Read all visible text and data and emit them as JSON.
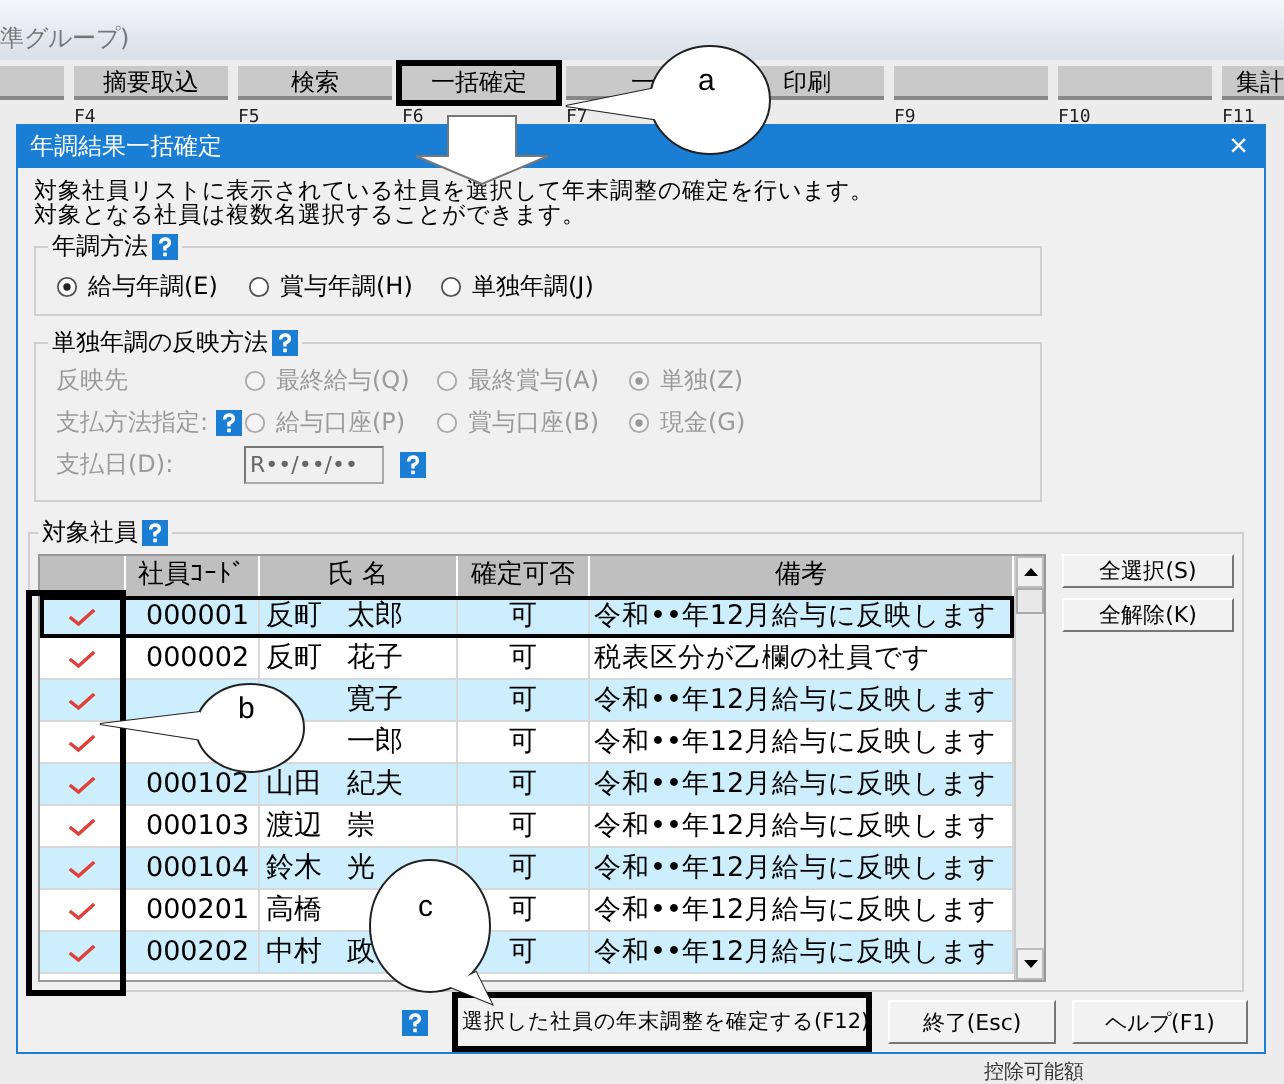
{
  "app": {
    "title": "準グループ)",
    "toolbar": [
      {
        "highlighted": false
      },
      {
        "label": "摘要取込",
        "fkey": "F4",
        "highlighted": false
      },
      {
        "label": "検索",
        "fkey": "F5",
        "highlighted": false
      },
      {
        "label": "一括確定",
        "fkey": "F6",
        "highlighted": true
      },
      {
        "label": "一",
        "fkey": "F7",
        "highlighted": false
      },
      {
        "label": "印刷",
        "highlighted": false
      },
      {
        "fkey": "F9",
        "highlighted": false
      },
      {
        "fkey": "F10",
        "highlighted": false
      },
      {
        "label": "集計",
        "fkey": "F11",
        "highlighted": false
      }
    ],
    "footer_text": "控除可能額"
  },
  "dialog": {
    "title": "年調結果一括確定",
    "close": "×",
    "intro": [
      "対象社員リストに表示されている社員を選択して年末調整の確定を行います。",
      "対象となる社員は複数名選択することができます。"
    ],
    "method": {
      "title": "年調方法",
      "help": true,
      "options": [
        {
          "label": "給与年調(E)",
          "selected": true
        },
        {
          "label": "賞与年調(H)",
          "selected": false
        },
        {
          "label": "単独年調(J)",
          "selected": false
        }
      ]
    },
    "reflect": {
      "title": "単独年調の反映方法",
      "help": true,
      "disabled": true,
      "rows": [
        {
          "kind": "radios",
          "label": "反映先",
          "help": false,
          "options": [
            {
              "label": "最終給与(Q)",
              "selected": false
            },
            {
              "label": "最終賞与(A)",
              "selected": false
            },
            {
              "label": "単独(Z)",
              "selected": true
            }
          ]
        },
        {
          "kind": "radios",
          "label": "支払方法指定:",
          "help": true,
          "options": [
            {
              "label": "給与口座(P)",
              "selected": false
            },
            {
              "label": "賞与口座(B)",
              "selected": false
            },
            {
              "label": "現金(G)",
              "selected": true
            }
          ]
        },
        {
          "kind": "date",
          "label": "支払日(D):",
          "value": "R••/••/••",
          "help": true
        }
      ]
    },
    "employees": {
      "title": "対象社員",
      "help": true,
      "check_column_highlighted": true,
      "columns": [
        "社員ｺｰﾄﾞ",
        "氏 名",
        "確定可否",
        "備考"
      ],
      "rows": [
        {
          "checked": true,
          "focused": true,
          "code": "000001",
          "family": "反町",
          "given": "太郎",
          "status": "可",
          "note": "令和••年12月給与に反映します"
        },
        {
          "checked": true,
          "focused": false,
          "code": "000002",
          "family": "反町",
          "given": "花子",
          "status": "可",
          "note": "税表区分が乙欄の社員です"
        },
        {
          "checked": true,
          "focused": false,
          "given": "寛子",
          "status": "可",
          "note": "令和••年12月給与に反映します"
        },
        {
          "checked": true,
          "focused": false,
          "given": "一郎",
          "status": "可",
          "note": "令和••年12月給与に反映します"
        },
        {
          "checked": true,
          "focused": false,
          "code": "000102",
          "family": "山田",
          "given": "紀夫",
          "status": "可",
          "note": "令和••年12月給与に反映します"
        },
        {
          "checked": true,
          "focused": false,
          "code": "000103",
          "family": "渡辺",
          "given": "崇",
          "status": "可",
          "note": "令和••年12月給与に反映します"
        },
        {
          "checked": true,
          "focused": false,
          "code": "000104",
          "family": "鈴木",
          "given": "光",
          "status": "可",
          "note": "令和••年12月給与に反映します"
        },
        {
          "checked": true,
          "focused": false,
          "code": "000201",
          "family": "高橋",
          "status": "可",
          "note": "令和••年12月給与に反映します"
        },
        {
          "checked": true,
          "focused": false,
          "code": "000202",
          "family": "中村",
          "given": "政",
          "status": "可",
          "note": "令和••年12月給与に反映します"
        }
      ],
      "buttons": [
        "全選択(S)",
        "全解除(K)"
      ]
    },
    "footer": {
      "help": true,
      "buttons": [
        {
          "label": "選択した社員の年末調整を確定する(F12)",
          "highlighted": true
        },
        {
          "label": "終了(Esc)",
          "highlighted": false
        },
        {
          "label": "ヘルプ(F1)",
          "highlighted": false
        }
      ]
    }
  },
  "annotations": [
    {
      "label": "a"
    },
    {
      "label": "b"
    },
    {
      "label": "c"
    }
  ]
}
